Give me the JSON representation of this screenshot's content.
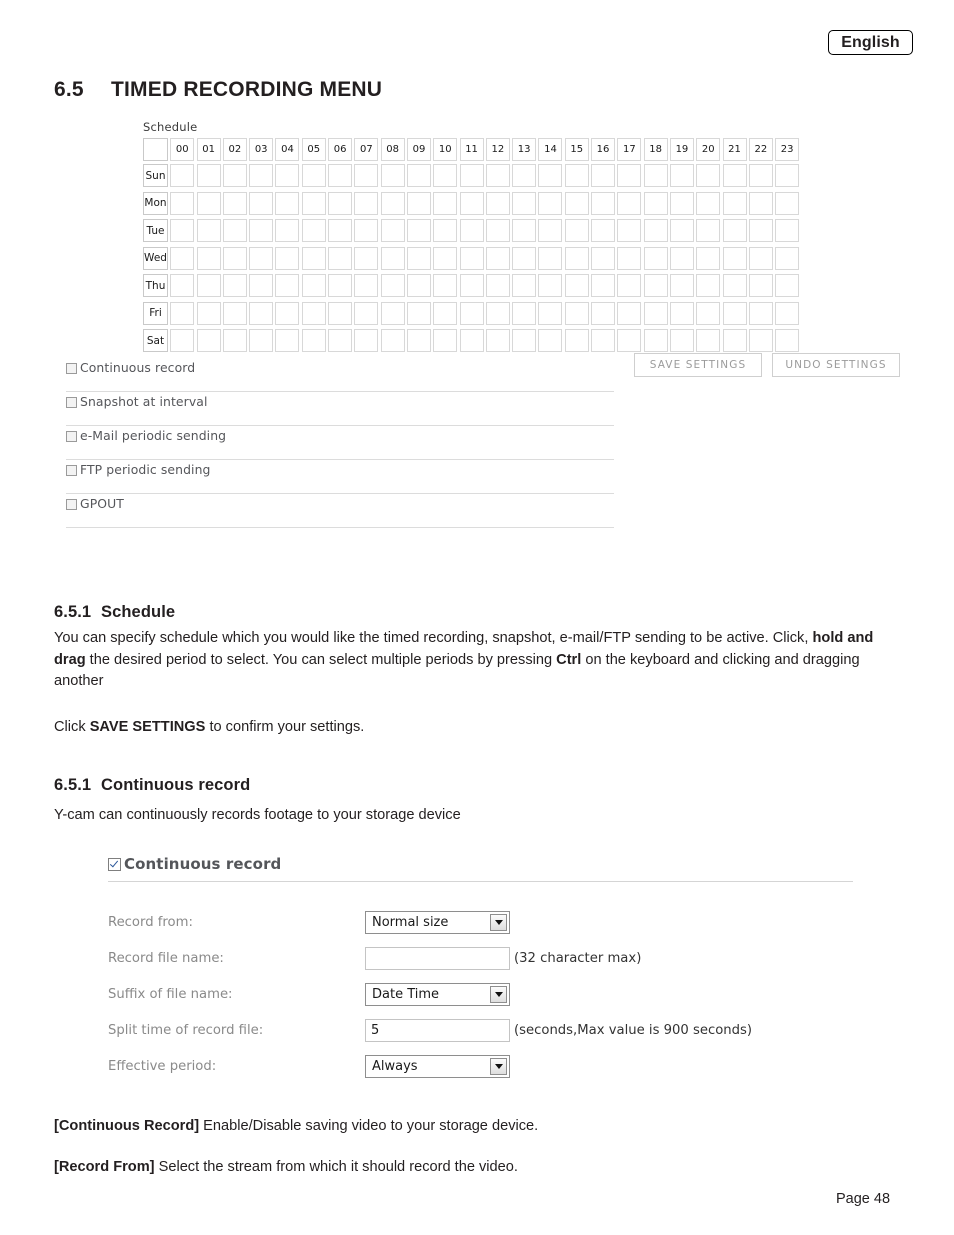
{
  "header": {
    "language_badge": "English"
  },
  "section": {
    "number": "6.5",
    "title": "TIMED RECORDING MENU"
  },
  "schedule_shot": {
    "label": "Schedule",
    "hours": [
      "00",
      "01",
      "02",
      "03",
      "04",
      "05",
      "06",
      "07",
      "08",
      "09",
      "10",
      "11",
      "12",
      "13",
      "14",
      "15",
      "16",
      "17",
      "18",
      "19",
      "20",
      "21",
      "22",
      "23"
    ],
    "days": [
      "Sun",
      "Mon",
      "Tue",
      "Wed",
      "Thu",
      "Fri",
      "Sat"
    ],
    "options": [
      {
        "label": "Continuous record",
        "checked": false
      },
      {
        "label": "Snapshot at interval",
        "checked": false
      },
      {
        "label": "e-Mail periodic sending",
        "checked": false
      },
      {
        "label": "FTP periodic sending",
        "checked": false
      },
      {
        "label": "GPOUT",
        "checked": false
      }
    ],
    "buttons": {
      "save": "SAVE SETTINGS",
      "undo": "UNDO SETTINGS"
    }
  },
  "subsection_schedule": {
    "number": "6.5.1",
    "title": "Schedule",
    "body_1a": "You can specify schedule which you would like the timed recording, snapshot, e-mail/FTP sending to be active. Click,",
    "body_1b": "hold and drag",
    "body_1c": " the desired period to select. You can select multiple periods by pressing ",
    "body_1d": "Ctrl",
    "body_1e": " on the keyboard and clicking and dragging another",
    "body_2a": "Click ",
    "body_2b": "SAVE SETTINGS",
    "body_2c": " to confirm your settings."
  },
  "subsection_continuous": {
    "number": "6.5.1",
    "title": "Continuous record",
    "intro": "Y-cam can continuously records footage to your storage device"
  },
  "continuous_panel": {
    "checkbox_label": "Continuous record",
    "checkbox_checked": true,
    "fields": [
      {
        "label": "Record from:",
        "type": "select",
        "value": "Normal size",
        "hint": ""
      },
      {
        "label": "Record file name:",
        "type": "text",
        "value": "",
        "hint": "(32 character max)"
      },
      {
        "label": "Suffix of file name:",
        "type": "select",
        "value": "Date Time",
        "hint": ""
      },
      {
        "label": "Split time of record file:",
        "type": "text",
        "value": "5",
        "hint": "(seconds,Max value is 900 seconds)"
      },
      {
        "label": "Effective period:",
        "type": "select",
        "value": "Always",
        "hint": ""
      }
    ]
  },
  "notes": {
    "note_1_term": "[Continuous Record]",
    "note_1_text": " Enable/Disable saving video to your storage device.",
    "note_2_term": "[Record From]",
    "note_2_text": " Select the stream from which it should record the video."
  },
  "footer": {
    "page": "Page 48"
  }
}
